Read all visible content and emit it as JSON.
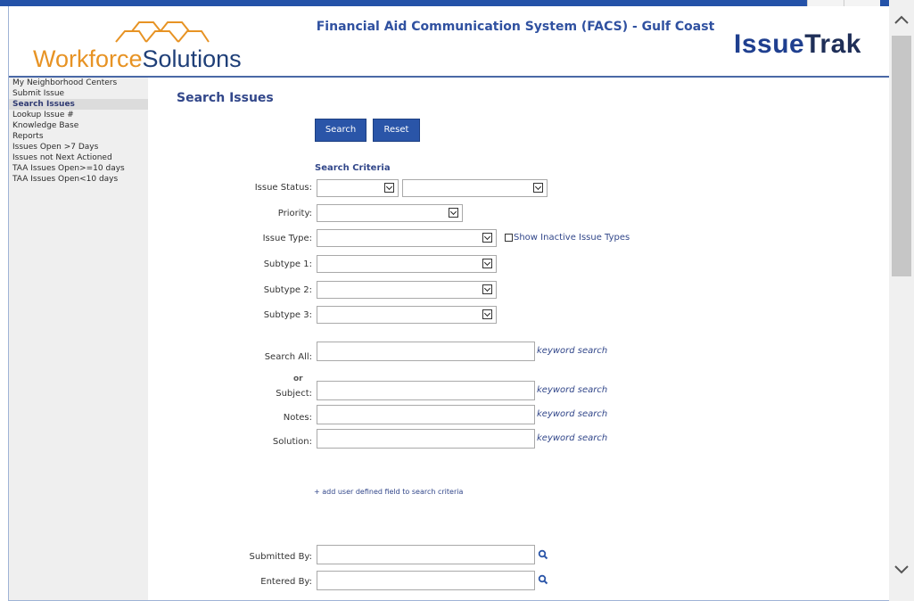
{
  "header": {
    "logo_word1": "Workforce",
    "logo_word2": "Solutions",
    "app_title": "Financial Aid Communication System (FACS) - Gulf Coast",
    "brand_a": "Issue",
    "brand_b": "Trak"
  },
  "sidebar": {
    "items": [
      {
        "label": "My Neighborhood Centers"
      },
      {
        "label": "Submit Issue"
      },
      {
        "label": "Search Issues"
      },
      {
        "label": "Lookup Issue #"
      },
      {
        "label": "Knowledge Base"
      },
      {
        "label": "Reports"
      },
      {
        "label": "Issues Open >7 Days"
      },
      {
        "label": "Issues not Next Actioned"
      },
      {
        "label": "TAA Issues Open>=10 days"
      },
      {
        "label": "TAA Issues Open<10 days"
      }
    ],
    "active_index": 2
  },
  "main": {
    "title": "Search Issues",
    "buttons": {
      "search": "Search",
      "reset": "Reset"
    },
    "criteria_title": "Search Criteria",
    "labels": {
      "issue_status": "Issue Status:",
      "priority": "Priority:",
      "issue_type": "Issue Type:",
      "subtype1": "Subtype 1:",
      "subtype2": "Subtype 2:",
      "subtype3": "Subtype 3:",
      "search_all": "Search All:",
      "or": "or",
      "subject": "Subject:",
      "notes": "Notes:",
      "solution": "Solution:",
      "submitted_by": "Submitted By:",
      "entered_by": "Entered By:"
    },
    "show_inactive_label": "Show Inactive Issue Types",
    "keyword_search_label": "keyword search",
    "add_udf_label": "+ add user defined field to search criteria",
    "fields": {
      "issue_status_1": "",
      "issue_status_2": "",
      "priority": "",
      "issue_type": "",
      "subtype1": "",
      "subtype2": "",
      "subtype3": "",
      "search_all": "",
      "subject": "",
      "notes": "",
      "solution": "",
      "submitted_by": "",
      "entered_by": ""
    }
  },
  "colors": {
    "accent_blue": "#2a55a8",
    "title_blue": "#32478a",
    "logo_orange": "#e79324",
    "sidebar_bg": "#efefef"
  }
}
